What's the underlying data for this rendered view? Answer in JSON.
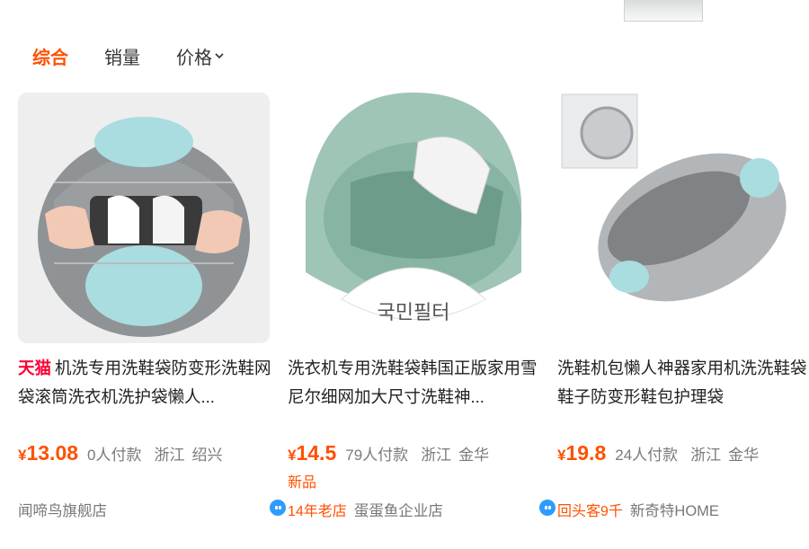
{
  "sort_tabs": [
    {
      "label": "综合",
      "active": true
    },
    {
      "label": "销量",
      "active": false
    },
    {
      "label": "价格",
      "active": false,
      "icon": "chevron-down-icon"
    }
  ],
  "products": [
    {
      "badge": "天猫",
      "title": "机洗专用洗鞋袋防变形洗鞋网袋滚筒洗衣机洗护袋懒人...",
      "currency": "¥",
      "price": "13.08",
      "sales": "0人付款",
      "province": "浙江",
      "city": "绍兴",
      "shop": "闻啼鸟旗舰店",
      "chat_icon": "wangwang-chat-icon",
      "image_text": ""
    },
    {
      "badge": "",
      "title": "洗衣机专用洗鞋袋韩国正版家用雪尼尔细网加大尺寸洗鞋神...",
      "currency": "¥",
      "price": "14.5",
      "sales": "79人付款",
      "province": "浙江",
      "city": "金华",
      "tag": "新品",
      "store_age": "14年老店",
      "shop": "蛋蛋鱼企业店",
      "chat_icon": "wangwang-chat-icon",
      "image_text": "국민필터"
    },
    {
      "badge": "",
      "title": "洗鞋机包懒人神器家用机洗洗鞋袋 鞋子防变形鞋包护理袋",
      "currency": "¥",
      "price": "19.8",
      "sales": "24人付款",
      "province": "浙江",
      "city": "金华",
      "repeat_buyers": "回头客9千",
      "shop": "新奇特HOME",
      "chat_icon": "wangwang-chat-icon",
      "image_text": ""
    }
  ],
  "colors": {
    "accent": "#ff5000",
    "tmall": "#ff0036",
    "chat": "#2f9bff"
  }
}
